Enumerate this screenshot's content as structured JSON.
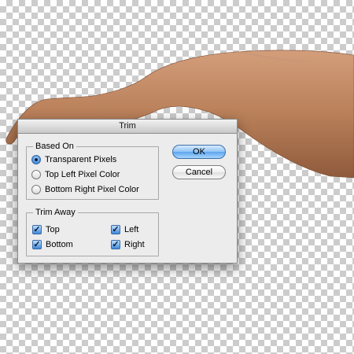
{
  "dialog": {
    "title": "Trim",
    "based_on": {
      "legend": "Based On",
      "options": [
        {
          "label": "Transparent Pixels",
          "selected": true
        },
        {
          "label": "Top Left Pixel Color",
          "selected": false
        },
        {
          "label": "Bottom Right Pixel Color",
          "selected": false
        }
      ]
    },
    "trim_away": {
      "legend": "Trim Away",
      "options": [
        {
          "label": "Top",
          "checked": true
        },
        {
          "label": "Left",
          "checked": true
        },
        {
          "label": "Bottom",
          "checked": true
        },
        {
          "label": "Right",
          "checked": true
        }
      ]
    },
    "buttons": {
      "ok": "OK",
      "cancel": "Cancel"
    }
  },
  "canvas": {
    "background": "transparent-checkerboard",
    "image_subject": "arm"
  }
}
